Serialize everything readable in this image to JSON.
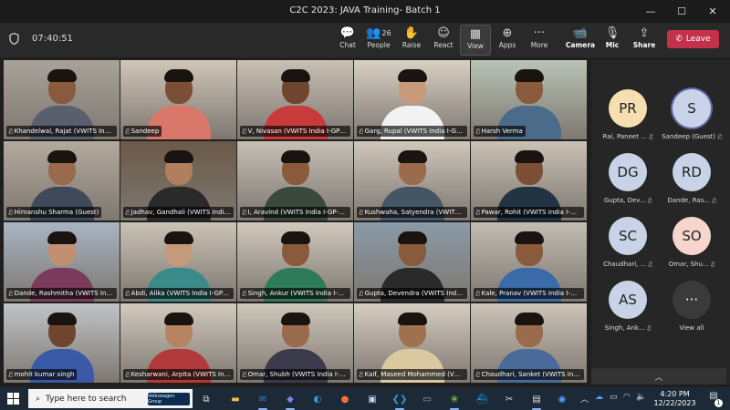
{
  "window": {
    "title": "C2C 2023: JAVA Training- Batch 1",
    "minimize": "—",
    "maximize": "☐",
    "close": "✕"
  },
  "toolbar": {
    "timer": "07:40:51",
    "buttons": [
      {
        "label": "Chat",
        "icon": "chat-icon",
        "glyph": "💬"
      },
      {
        "label": "People",
        "icon": "people-icon",
        "glyph": "👥",
        "count": "26"
      },
      {
        "label": "Raise",
        "icon": "raise-hand-icon",
        "glyph": "✋"
      },
      {
        "label": "React",
        "icon": "react-icon",
        "glyph": "☺"
      },
      {
        "label": "View",
        "icon": "view-icon",
        "glyph": "▦"
      },
      {
        "label": "Apps",
        "icon": "apps-icon",
        "glyph": "⊕"
      },
      {
        "label": "More",
        "icon": "more-icon",
        "glyph": "···"
      },
      {
        "label": "Camera",
        "icon": "camera-icon",
        "glyph": "📹"
      },
      {
        "label": "Mic",
        "icon": "mic-icon",
        "glyph": "🎙"
      },
      {
        "label": "Share",
        "icon": "share-icon",
        "glyph": "⇪"
      }
    ],
    "leave_label": "Leave"
  },
  "tiles": [
    {
      "name": "Khandelwal, Rajat (VWITS India I-...",
      "bg": "#a9a29a",
      "shirt": "#5a5f6e",
      "skin": "#8a5a3c"
    },
    {
      "name": "Sandeep",
      "bg": "#cfc6b8",
      "shirt": "#d9776a",
      "skin": "#7a4f35"
    },
    {
      "name": "V, Nivasan (VWITS India I-GP-L/1)",
      "bg": "#c8c0b4",
      "shirt": "#c93b3b",
      "skin": "#6f4530"
    },
    {
      "name": "Garg, Rupal (VWITS India I-GP-L...",
      "bg": "#d8d0c4",
      "shirt": "#f2f2f2",
      "skin": "#c99a7a"
    },
    {
      "name": "Harsh Verma",
      "bg": "#b9c3b6",
      "shirt": "#4a6b8a",
      "skin": "#8a5a3c"
    },
    {
      "name": "Himanshu Sharma (Guest)",
      "bg": "#b3aa9e",
      "shirt": "#3e4a5a",
      "skin": "#9a6a4c"
    },
    {
      "name": "Jadhav, Gandhali (VWITS India I-G...",
      "bg": "#6b5a48",
      "shirt": "#2a2a2a",
      "skin": "#b07f60"
    },
    {
      "name": "I, Aravind (VWITS India I-GP-L/1)",
      "bg": "#c6bfb4",
      "shirt": "#3a4a3a",
      "skin": "#8a5a3c"
    },
    {
      "name": "Kushwaha, Satyendra (VWITS In...",
      "bg": "#cfc7bb",
      "shirt": "#445566",
      "skin": "#9a6a4c"
    },
    {
      "name": "Pawar, Rohit (VWITS India I-GP-...",
      "bg": "#c9c1b5",
      "shirt": "#223344",
      "skin": "#7a4f35"
    },
    {
      "name": "Dande, Rashmitha (VWITS India I-...",
      "bg": "#a8b4c4",
      "shirt": "#7a3a5a",
      "skin": "#c09070"
    },
    {
      "name": "Abdi, Alika (VWITS India I-GP-L/1)",
      "bg": "#cac2b6",
      "shirt": "#3a8a8a",
      "skin": "#c79a7b"
    },
    {
      "name": "Singh, Ankur (VWITS India I-GP-L...",
      "bg": "#d1c9bd",
      "shirt": "#2f7a5a",
      "skin": "#8a5a3c"
    },
    {
      "name": "Gupta, Devendra (VWITS India I-...",
      "bg": "#8a9aa8",
      "shirt": "#2a2a2a",
      "skin": "#8a5a3c"
    },
    {
      "name": "Kale, Pranav (VWITS India I-GP-L...",
      "bg": "#c2bcb2",
      "shirt": "#3a6aa8",
      "skin": "#8a5a3c"
    },
    {
      "name": "mohit kumar singh",
      "bg": "#c0c4c8",
      "shirt": "#3a5aa8",
      "skin": "#6f4530"
    },
    {
      "name": "Kesharwani, Arpita (VWITS India I-...",
      "bg": "#d2cabe",
      "shirt": "#b33a3a",
      "skin": "#b58462"
    },
    {
      "name": "Omar, Shubh (VWITS India I-GP-L...",
      "bg": "#cfc7bb",
      "shirt": "#3a3a4a",
      "skin": "#9a6a4c"
    },
    {
      "name": "Kaif, Maseed Mohammed (VWIT...",
      "bg": "#d6cec2",
      "shirt": "#d8c9a0",
      "skin": "#a0704f"
    },
    {
      "name": "Chaudhari, Sanket (VWITS India I-...",
      "bg": "#ccc4b8",
      "shirt": "#4a6a9a",
      "skin": "#9a6a4c"
    }
  ],
  "participants": [
    {
      "initials": "PR",
      "name": "Rai, Paneet ...",
      "color": "#f5dfb0",
      "ring": false
    },
    {
      "initials": "S",
      "name": "Sandeep (Guest)",
      "color": "#c8d3e8",
      "ring": true
    },
    {
      "initials": "DG",
      "name": "Gupta, Dev...",
      "color": "#c8d3e8",
      "ring": false
    },
    {
      "initials": "RD",
      "name": "Dande, Ras...",
      "color": "#c8d3e8",
      "ring": false
    },
    {
      "initials": "SC",
      "name": "Chaudhari, ...",
      "color": "#c8d3e8",
      "ring": false
    },
    {
      "initials": "SO",
      "name": "Omar, Shu...",
      "color": "#f7d5cf",
      "ring": false
    },
    {
      "initials": "AS",
      "name": "Singh, Ank...",
      "color": "#c8d3e8",
      "ring": false
    },
    {
      "initials": "···",
      "name": "View all",
      "color": "#3a3a3a",
      "ring": false
    }
  ],
  "taskbar": {
    "search_placeholder": "Type here to search",
    "promo_text": "Volkswagen Group",
    "time": "4:20 PM",
    "date": "12/22/2023",
    "notification_count": "1"
  }
}
